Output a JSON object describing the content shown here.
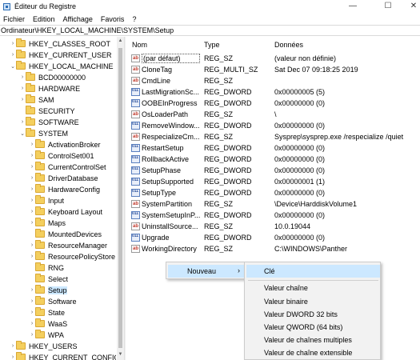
{
  "window": {
    "title": "Éditeur du Registre",
    "controls": {
      "minimize": "—",
      "maximize": "☐",
      "close": "✕"
    }
  },
  "menu": [
    "Fichier",
    "Edition",
    "Affichage",
    "Favoris",
    "?"
  ],
  "address": "Ordinateur\\HKEY_LOCAL_MACHINE\\SYSTEM\\Setup",
  "tree": {
    "hkcr": "HKEY_CLASSES_ROOT",
    "hkcu": "HKEY_CURRENT_USER",
    "hklm": "HKEY_LOCAL_MACHINE",
    "bcd": "BCD00000000",
    "hardware": "HARDWARE",
    "sam": "SAM",
    "security": "SECURITY",
    "software": "SOFTWARE",
    "system": "SYSTEM",
    "activationbroker": "ActivationBroker",
    "controlset001": "ControlSet001",
    "currentcontrolset": "CurrentControlSet",
    "driverdatabase": "DriverDatabase",
    "hardwareconfig": "HardwareConfig",
    "input": "Input",
    "keyboardlayout": "Keyboard Layout",
    "maps": "Maps",
    "mounteddevices": "MountedDevices",
    "resourcemanager": "ResourceManager",
    "resourcepolicystore": "ResourcePolicyStore",
    "rng": "RNG",
    "select": "Select",
    "setup": "Setup",
    "software2": "Software",
    "state": "State",
    "waas": "WaaS",
    "wpa": "WPA",
    "hku": "HKEY_USERS",
    "hkcc": "HKEY_CURRENT_CONFIG"
  },
  "columns": {
    "name": "Nom",
    "type": "Type",
    "data": "Données"
  },
  "values": [
    {
      "icon": "ab",
      "name": "(par défaut)",
      "type": "REG_SZ",
      "data": "(valeur non définie)"
    },
    {
      "icon": "ab",
      "name": "CloneTag",
      "type": "REG_MULTI_SZ",
      "data": "Sat Dec 07 09:18:25 2019"
    },
    {
      "icon": "ab",
      "name": "CmdLine",
      "type": "REG_SZ",
      "data": ""
    },
    {
      "icon": "bin",
      "name": "LastMigrationSc...",
      "type": "REG_DWORD",
      "data": "0x00000005 (5)"
    },
    {
      "icon": "bin",
      "name": "OOBEInProgress",
      "type": "REG_DWORD",
      "data": "0x00000000 (0)"
    },
    {
      "icon": "ab",
      "name": "OsLoaderPath",
      "type": "REG_SZ",
      "data": "\\"
    },
    {
      "icon": "bin",
      "name": "RemoveWindow...",
      "type": "REG_DWORD",
      "data": "0x00000000 (0)"
    },
    {
      "icon": "ab",
      "name": "RespecializeCm...",
      "type": "REG_SZ",
      "data": "Sysprep\\sysprep.exe /respecialize /quiet"
    },
    {
      "icon": "bin",
      "name": "RestartSetup",
      "type": "REG_DWORD",
      "data": "0x00000000 (0)"
    },
    {
      "icon": "bin",
      "name": "RollbackActive",
      "type": "REG_DWORD",
      "data": "0x00000000 (0)"
    },
    {
      "icon": "bin",
      "name": "SetupPhase",
      "type": "REG_DWORD",
      "data": "0x00000000 (0)"
    },
    {
      "icon": "bin",
      "name": "SetupSupported",
      "type": "REG_DWORD",
      "data": "0x00000001 (1)"
    },
    {
      "icon": "bin",
      "name": "SetupType",
      "type": "REG_DWORD",
      "data": "0x00000000 (0)"
    },
    {
      "icon": "ab",
      "name": "SystemPartition",
      "type": "REG_SZ",
      "data": "\\Device\\HarddiskVolume1"
    },
    {
      "icon": "bin",
      "name": "SystemSetupInP...",
      "type": "REG_DWORD",
      "data": "0x00000000 (0)"
    },
    {
      "icon": "ab",
      "name": "UninstallSource...",
      "type": "REG_SZ",
      "data": "10.0.19044"
    },
    {
      "icon": "bin",
      "name": "Upgrade",
      "type": "REG_DWORD",
      "data": "0x00000000 (0)"
    },
    {
      "icon": "ab",
      "name": "WorkingDirectory",
      "type": "REG_SZ",
      "data": "C:\\WINDOWS\\Panther"
    }
  ],
  "context_menu": {
    "nouveau": "Nouveau",
    "arrow": "›",
    "submenu": {
      "cle": "Clé",
      "chaine": "Valeur chaîne",
      "binaire": "Valeur binaire",
      "dword": "Valeur DWORD 32 bits",
      "qword": "Valeur QWORD (64 bits)",
      "multi": "Valeur de chaînes multiples",
      "extensible": "Valeur de chaîne extensible"
    }
  },
  "icons": {
    "ab": "ab",
    "bin": "011 110"
  },
  "colors": {
    "selection": "#cce8ff",
    "folder": "#f4cf5e",
    "menu_bg": "#f2f2f2"
  }
}
